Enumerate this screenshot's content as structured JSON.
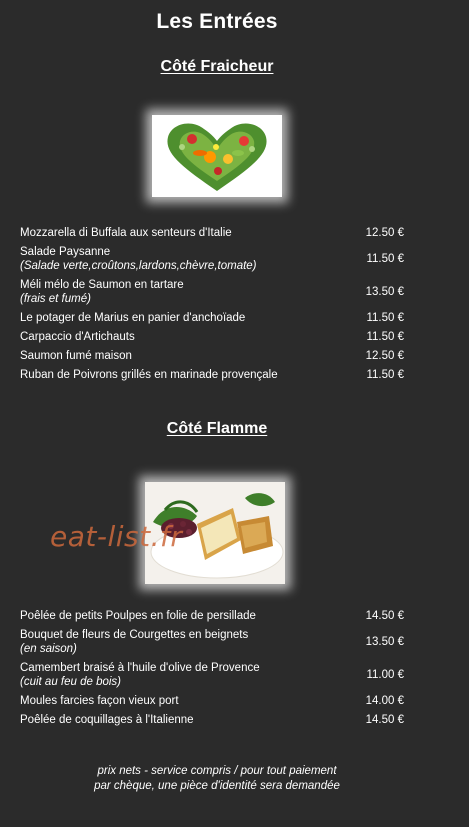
{
  "page": {
    "title": "Les Entrées"
  },
  "sections": [
    {
      "title": "Côté Fraicheur",
      "items": [
        {
          "name": "Mozzarella di Buffala aux senteurs d'Italie",
          "desc": "",
          "price": "12.50 €"
        },
        {
          "name": "Salade Paysanne",
          "desc": "(Salade verte,croûtons,lardons,chèvre,tomate)",
          "price": "11.50 €"
        },
        {
          "name": "Méli mélo de Saumon en tartare",
          "desc": "(frais et fumé)",
          "price": "13.50 €"
        },
        {
          "name": "Le potager de Marius en panier d'anchoïade",
          "desc": "",
          "price": "11.50 €"
        },
        {
          "name": "Carpaccio d'Artichauts",
          "desc": "",
          "price": "11.50 €"
        },
        {
          "name": "Saumon fumé maison",
          "desc": "",
          "price": "12.50 €"
        },
        {
          "name": "Ruban de Poivrons grillés en marinade provençale",
          "desc": "",
          "price": "11.50 €"
        }
      ]
    },
    {
      "title": "Côté Flamme",
      "items": [
        {
          "name": "Poêlée de petits Poulpes en folie de persillade",
          "desc": "",
          "price": "14.50 €"
        },
        {
          "name": "Bouquet de fleurs de Courgettes en beignets",
          "desc": "(en saison)",
          "price": "13.50 €"
        },
        {
          "name": "Camembert braisé à l'huile d'olive de Provence",
          "desc": "(cuit au feu de bois)",
          "price": "11.00 €"
        },
        {
          "name": "Moules farcies façon vieux port",
          "desc": "",
          "price": "14.00 €"
        },
        {
          "name": "Poêlée de coquillages à l'Italienne",
          "desc": "",
          "price": "14.50 €"
        }
      ]
    }
  ],
  "images": {
    "vegetable_heart": "vegetable-heart-photo",
    "camembert_dish": "fried-camembert-photo"
  },
  "watermark": "eat-list.fr",
  "footer": {
    "line1": "prix nets - service compris / pour tout paiement",
    "line2": "par chèque, une pièce d'identité sera demandée"
  }
}
